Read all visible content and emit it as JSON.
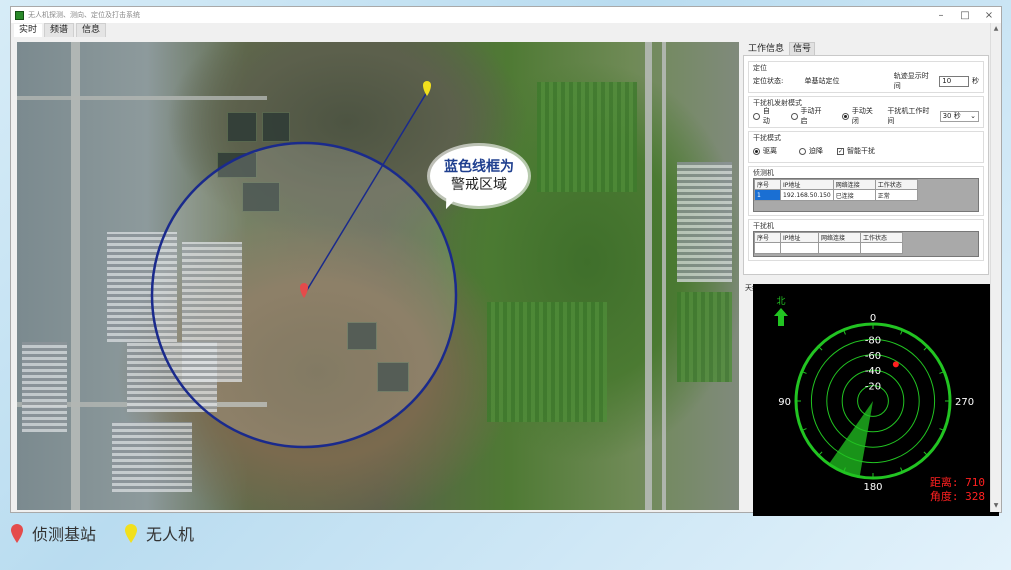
{
  "window": {
    "title": "无人机探测、测向、定位及打击系统",
    "controls": {
      "minimize": "–",
      "maximize": "□",
      "close": "×"
    }
  },
  "menu": {
    "items": [
      "实时",
      "频谱",
      "信息"
    ]
  },
  "map": {
    "callout": {
      "line1": "蓝色线框为",
      "line2": "警戒区域"
    },
    "warning_circle_color": "#1a2a8c",
    "detection_marker_color": "#e44b4b",
    "drone_marker_color": "#f2e01d"
  },
  "info_panel": {
    "tabs": [
      "工作信息",
      "信号"
    ],
    "positioning": {
      "group_title": "定位",
      "status_label": "定位状态:",
      "status_value": "单基站定位",
      "track_time_label": "轨迹显示时间",
      "track_time_value": "10",
      "track_time_unit": "秒"
    },
    "jammer_emission": {
      "group_title": "干扰机发射模式",
      "options": [
        {
          "label": "自动",
          "checked": false
        },
        {
          "label": "手动开启",
          "checked": false
        },
        {
          "label": "手动关闭",
          "checked": true
        }
      ],
      "work_time_label": "干扰机工作时间",
      "work_time_value": "30 秒"
    },
    "jam_mode": {
      "group_title": "干扰模式",
      "options": [
        {
          "label": "驱离",
          "type": "radio",
          "checked": true
        },
        {
          "label": "迫降",
          "type": "radio",
          "checked": false
        },
        {
          "label": "智能干扰",
          "type": "check",
          "checked": true
        }
      ]
    },
    "detector": {
      "group_title": "侦测机",
      "columns": [
        "序号",
        "IP地址",
        "网络连接",
        "工作状态"
      ],
      "rows": [
        {
          "index": "1",
          "ip": "192.168.50.150",
          "conn": "已连接",
          "status": "正常"
        }
      ]
    },
    "jammer": {
      "group_title": "干扰机",
      "columns": [
        "序号",
        "IP地址",
        "网络连接",
        "工作状态"
      ],
      "rows": []
    }
  },
  "antenna": {
    "label": "天线",
    "north_label": "北",
    "ring_labels": [
      "0",
      "-80",
      "-60",
      "-40",
      "-20"
    ],
    "bearing_labels": {
      "top": "0",
      "right": "270",
      "bottom": "180",
      "left": "90"
    },
    "distance_label": "距离: 710",
    "angle_label": "角度: 328",
    "target_bearing_deg": 328,
    "radar_color": "#22c422",
    "target_color": "#ff2020"
  },
  "legend": {
    "items": [
      {
        "label": "侦测基站",
        "color": "#e44b4b"
      },
      {
        "label": "无人机",
        "color": "#f2e01d"
      }
    ]
  }
}
